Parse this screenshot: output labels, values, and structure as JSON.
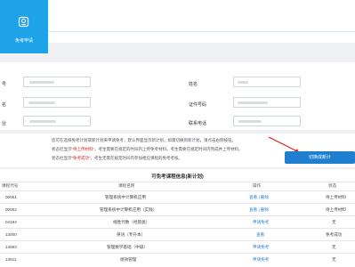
{
  "header": {
    "tab_label": "免考申请"
  },
  "form": {
    "row1": {
      "left_label": "号",
      "right_label": "姓名"
    },
    "row2": {
      "left_label": "名",
      "right_label": "证件号码"
    },
    "row3": {
      "left_label": "业",
      "right_label": "联系电话"
    }
  },
  "notes": [
    {
      "pre": "您可在选择免考计划或新计划来申请免考，默认界面显示新计划，如需切换到新计划，请点击右侧按钮。",
      "red": "",
      "post": ""
    },
    {
      "pre": "状态栏显示“",
      "red": "待上传材料",
      "post": "”，考生需要在规定的时间内上传免考材料。考生需要在规定时间内完成并上传材料。"
    },
    {
      "pre": "状态栏显示“",
      "red": "免考成功",
      "post": "”，考生无需在规定时间内参加相应课程的免考考核。"
    }
  ],
  "print_button": "切换成新计",
  "table": {
    "title": "可免考课程信息(新计划)",
    "headers": [
      "课程代号",
      "课程名称",
      "操作",
      "状态"
    ],
    "rows": [
      {
        "code": "00051",
        "name": "管理系统中计算机应用",
        "action": "查看 | 删除",
        "status": "待上传材料"
      },
      {
        "code": "00052",
        "name": "管理系统中计算机应用（实践）",
        "action": "查看 | 删除",
        "status": "待上传材料"
      },
      {
        "code": "04184",
        "name": "线性代数（经管类）",
        "action": "申请免考",
        "status": "无"
      },
      {
        "code": "13000",
        "name": "英语（专升本）",
        "action": "查看",
        "status": "免考成功"
      },
      {
        "code": "13683",
        "name": "管理数学基础（中级）",
        "action": "申请免考",
        "status": "无"
      },
      {
        "code": "13811",
        "name": "绩效管理",
        "action": "申请免考",
        "status": "无"
      }
    ]
  }
}
